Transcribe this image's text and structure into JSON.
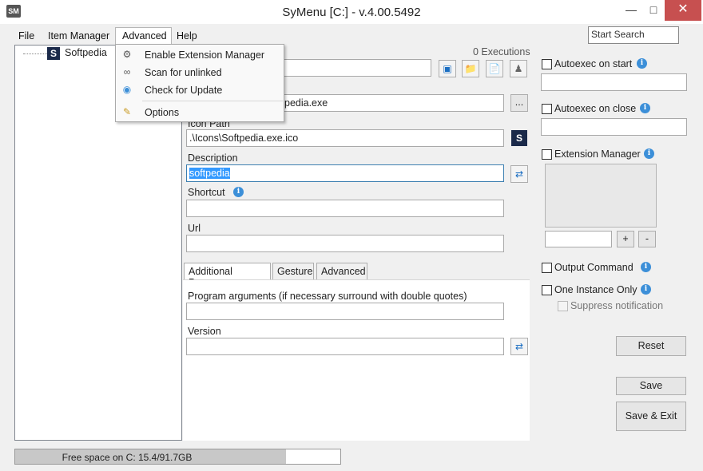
{
  "window": {
    "title": "SyMenu [C:] - v.4.00.5492",
    "app_icon": "SM",
    "minimize": "—",
    "maximize": "□",
    "close": "✕"
  },
  "menu": {
    "file": "File",
    "item_manager": "Item Manager",
    "advanced": "Advanced",
    "help": "Help"
  },
  "search": {
    "placeholder": "Start Search"
  },
  "tree": {
    "root_label": "Softpedia",
    "root_icon": "S"
  },
  "dropdown": [
    {
      "icon": "extension-icon",
      "label": "Enable Extension Manager"
    },
    {
      "icon": "unlink-icon",
      "label": "Scan for unlinked"
    },
    {
      "icon": "update-icon",
      "label": "Check for Update"
    },
    {
      "icon": "options-icon",
      "label": "Options"
    }
  ],
  "main": {
    "executions": "0 Executions",
    "path_value": "pedia.exe",
    "browse_label": "...",
    "icon_path_label": "Icon Path",
    "icon_path_value": ".\\Icons\\Softpedia.exe.ico",
    "icon_preview": "S",
    "description_label": "Description",
    "description_value": "softpedia",
    "shortcut_label": "Shortcut",
    "url_label": "Url",
    "tabs": [
      "Additional Params",
      "Gesture",
      "Advanced"
    ],
    "program_args_label": "Program arguments (if necessary surround with double quotes)",
    "version_label": "Version"
  },
  "right": {
    "autoexec_start": "Autoexec on start",
    "autoexec_close": "Autoexec on close",
    "extension_manager": "Extension Manager",
    "plus": "+",
    "minus": "-",
    "output_command": "Output Command",
    "one_instance": "One Instance Only",
    "suppress": "Suppress notification",
    "reset": "Reset",
    "save": "Save",
    "save_exit": "Save & Exit"
  },
  "status": {
    "text": "Free space on C: 15.4/91.7GB",
    "used_fraction": 0.832
  },
  "colors": {
    "accent": "#3399ff",
    "close": "#c75050",
    "info": "#3c8fd8"
  }
}
